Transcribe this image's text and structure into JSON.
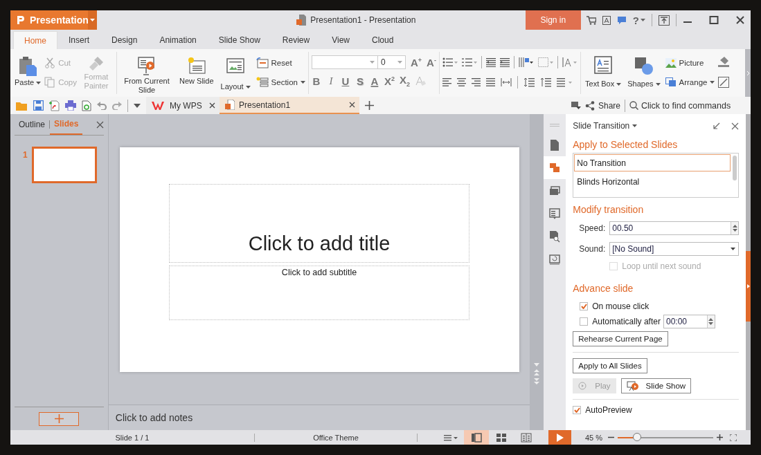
{
  "app_menu": {
    "label": "Presentation"
  },
  "window": {
    "title": "Presentation1 - Presentation"
  },
  "sign_in": {
    "label": "Sign in"
  },
  "help": {
    "label": "?"
  },
  "ribbon_tabs": [
    {
      "label": "Home",
      "selected": true
    },
    {
      "label": "Insert",
      "selected": false
    },
    {
      "label": "Design",
      "selected": false
    },
    {
      "label": "Animation",
      "selected": false
    },
    {
      "label": "Slide Show",
      "selected": false
    },
    {
      "label": "Review",
      "selected": false
    },
    {
      "label": "View",
      "selected": false
    },
    {
      "label": "Cloud",
      "selected": false
    }
  ],
  "clipboard": {
    "paste": {
      "label": "Paste"
    },
    "cut": {
      "label": "Cut",
      "disabled": true
    },
    "copy": {
      "label": "Copy",
      "disabled": true
    },
    "format_painter": {
      "label": "Format Painter",
      "disabled": true
    }
  },
  "slides_group": {
    "from_current_slide": "From Current Slide",
    "new_slide": "New Slide",
    "layout": "Layout",
    "reset": "Reset",
    "section": "Section"
  },
  "font": {
    "size": "0",
    "grow": "A$^{+}$",
    "shrink": "A$^{-}$",
    "styles": [
      {
        "kind": "bold",
        "label": "B"
      },
      {
        "kind": "italic",
        "label": "I"
      },
      {
        "kind": "underline",
        "label": "U"
      },
      {
        "kind": "shadow",
        "label": "S"
      },
      {
        "kind": "color",
        "label": "A"
      },
      {
        "kind": "superscript",
        "label": "X$^{2}$"
      },
      {
        "kind": "subscript",
        "label": "X$_{2}$"
      }
    ]
  },
  "drawing": {
    "text_box": "Text Box",
    "shapes": "Shapes",
    "picture": "Picture",
    "arrange": "Arrange"
  },
  "doc_tabs": [
    {
      "label": "My WPS",
      "selected": false
    },
    {
      "label": "Presentation1",
      "selected": true
    }
  ],
  "share": {
    "label": "Share"
  },
  "command_search": {
    "placeholder": "Click to find commands"
  },
  "left_panel": {
    "tabs": [
      {
        "label": "Outline",
        "selected": false
      },
      {
        "label": "Slides",
        "selected": true
      }
    ],
    "thumbnails": [
      {
        "number": "1",
        "selected": true
      }
    ]
  },
  "slide": {
    "title_placeholder": "Click to add title",
    "subtitle_placeholder": "Click to add subtitle"
  },
  "notes": {
    "placeholder": "Click to add notes"
  },
  "side_tabs": [
    {
      "selected": false
    },
    {
      "selected": true
    },
    {
      "selected": false
    },
    {
      "selected": false
    },
    {
      "selected": false
    },
    {
      "selected": false
    }
  ],
  "task_pane": {
    "title": "Slide Transition",
    "apply_heading": "Apply to Selected Slides",
    "transitions": [
      {
        "label": "No Transition",
        "selected": true
      },
      {
        "label": "Blinds Horizontal",
        "selected": false
      }
    ],
    "modify_heading": "Modify transition",
    "speed": {
      "label": "Speed:",
      "value": "00.50"
    },
    "sound": {
      "label": "Sound:",
      "value": "[No Sound]"
    },
    "loop": {
      "label": "Loop until next sound",
      "checked": false,
      "disabled": true
    },
    "advance_heading": "Advance slide",
    "on_mouse_click": {
      "label": "On mouse click",
      "checked": true
    },
    "auto_after": {
      "label": "Automatically after",
      "checked": false,
      "value": "00:00"
    },
    "rehearse": "Rehearse Current Page",
    "apply_all": "Apply to All Slides",
    "play": {
      "label": "Play",
      "disabled": true
    },
    "slide_show": "Slide Show",
    "autopreview": {
      "label": "AutoPreview",
      "checked": true
    }
  },
  "status_bar": {
    "slide": "Slide 1 / 1",
    "theme": "Office Theme",
    "views": [
      {
        "selected": true
      },
      {
        "selected": false
      },
      {
        "selected": false
      }
    ],
    "zoom": {
      "label": "45 %",
      "level": 0.2
    }
  }
}
